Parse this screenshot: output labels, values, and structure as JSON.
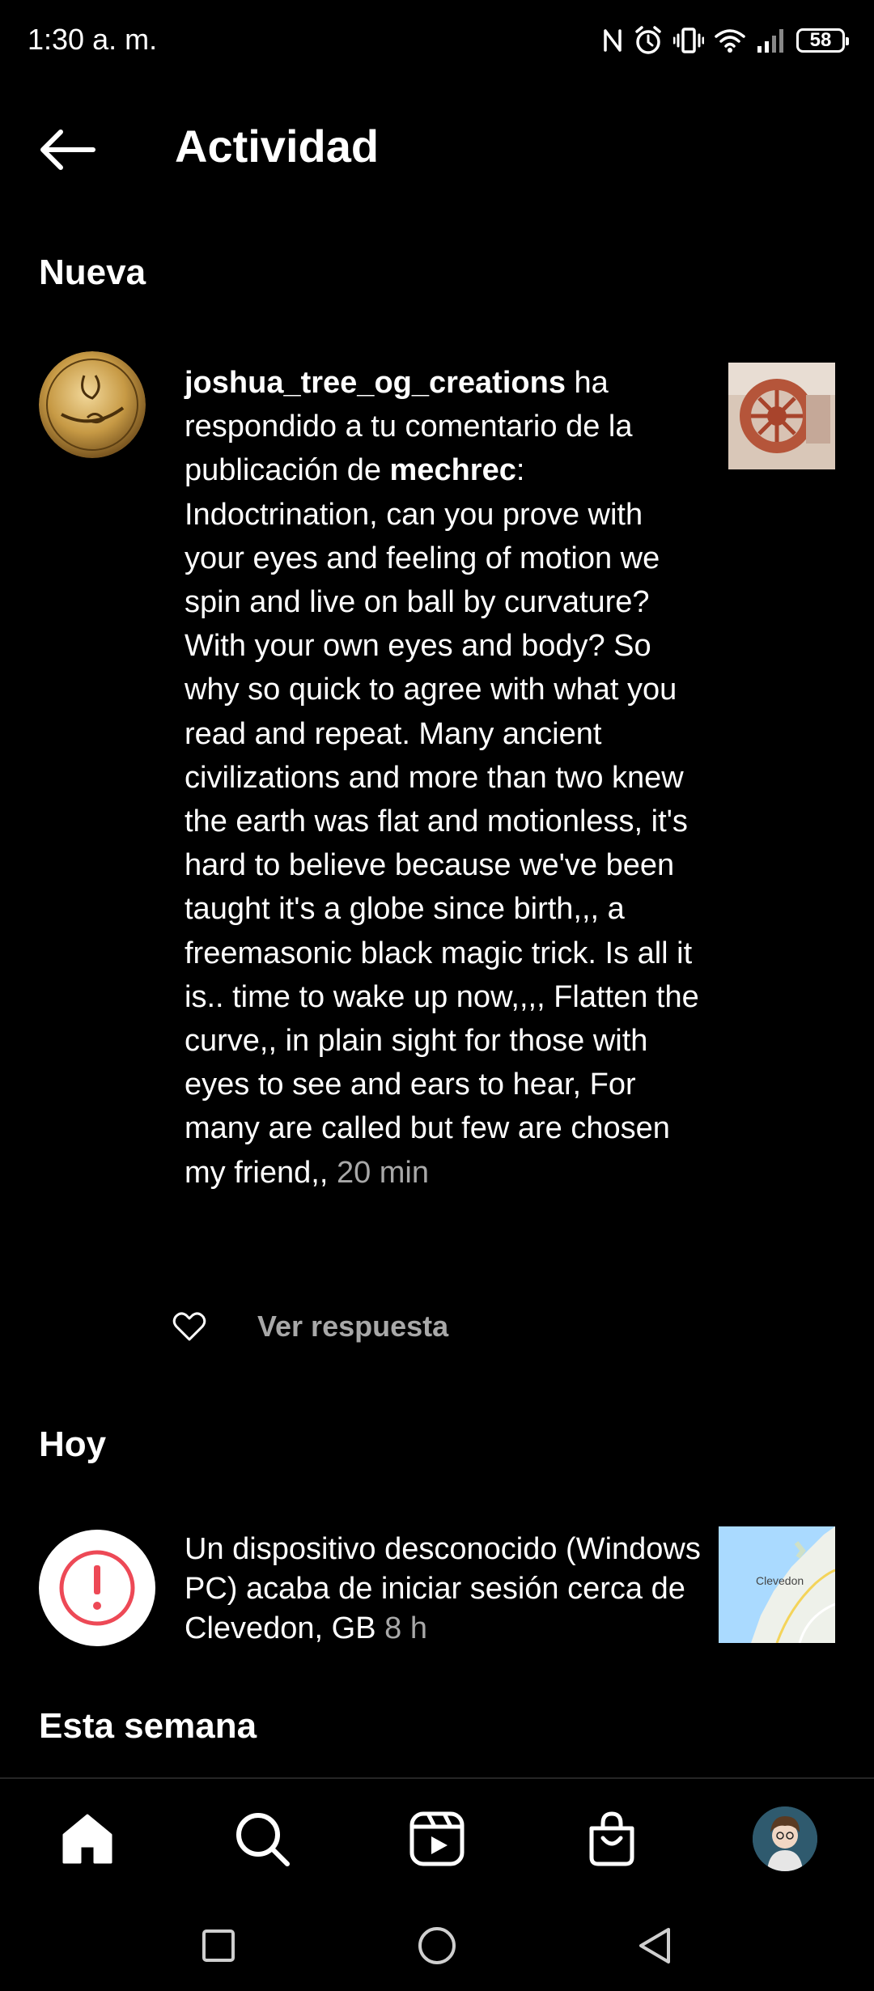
{
  "status_bar": {
    "time": "1:30 a. m.",
    "battery": "58"
  },
  "header": {
    "title": "Actividad",
    "back_icon": "arrow-left-icon"
  },
  "sections": {
    "new": "Nueva",
    "today": "Hoy",
    "this_week": "Esta semana"
  },
  "notification_1": {
    "username": "joshua_tree_og_creations",
    "text_a": " ha respondido a tu comentario de la publicación de ",
    "post_owner": "mechrec",
    "text_b": ": Indoctrination, can you prove with your eyes and feeling of motion we spin and live on ball by curvature? With your own eyes and body? So why so quick to agree with what you read and repeat. Many ancient civilizations and more than two knew the earth was flat and motionless, it's hard to believe because we've been taught it's a globe since birth,,, a freemasonic black magic trick. Is all it is.. time to wake up now,,,, Flatten the curve,, in plain sight for those with eyes to see and ears to hear, For many are called but few are chosen my friend,, ",
    "time": "20 min",
    "reply_label": "Ver respuesta"
  },
  "notification_2": {
    "text": "Un dispositivo desconocido (Windows PC) acaba de iniciar sesión cerca de Clevedon, GB ",
    "time": "8 h",
    "map_label": "Clevedon"
  },
  "colors": {
    "background": "#000000",
    "text": "#ffffff",
    "muted": "#a8a8a8",
    "alert_red": "#ed4956"
  }
}
